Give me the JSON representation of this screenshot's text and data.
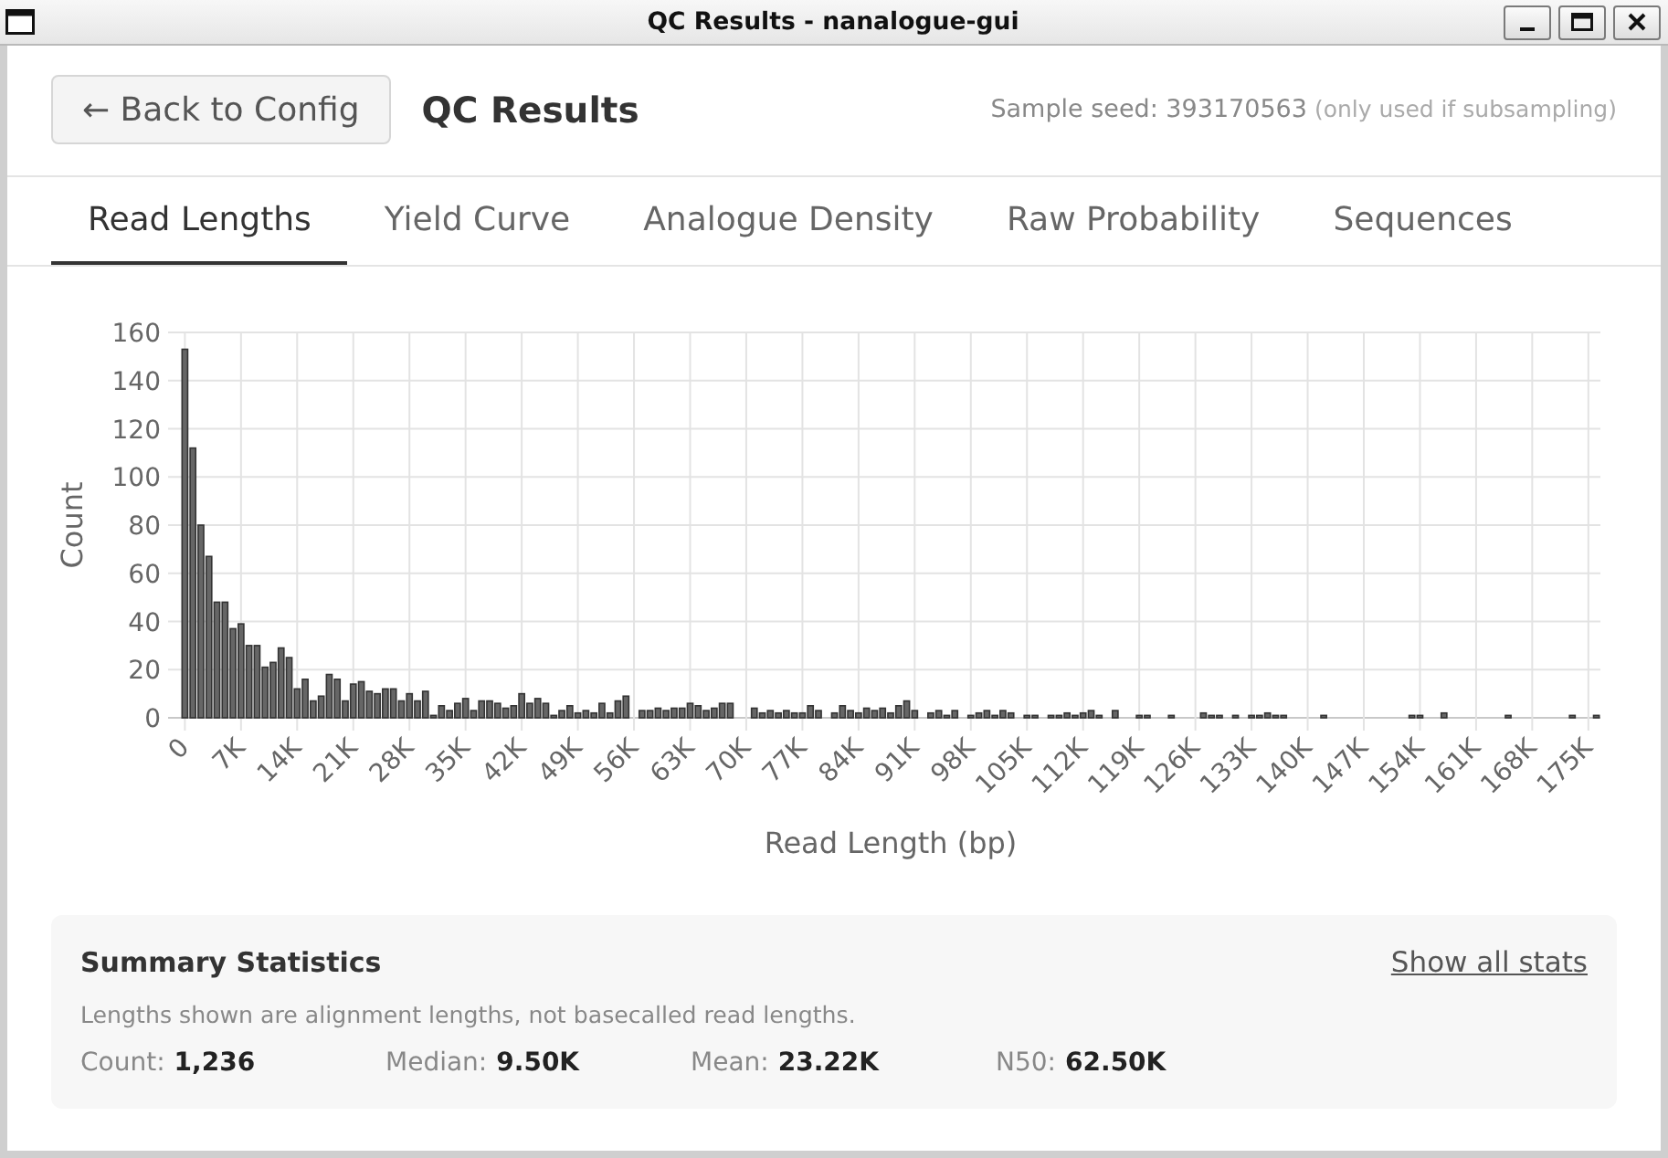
{
  "window": {
    "title": "QC Results - nanalogue-gui"
  },
  "header": {
    "back_button": "← Back to Config",
    "title": "QC Results",
    "seed": "Sample seed: 393170563",
    "seed_note": "(only used if subsampling)"
  },
  "tabs": [
    {
      "label": "Read Lengths",
      "selected": true
    },
    {
      "label": "Yield Curve",
      "selected": false
    },
    {
      "label": "Analogue Density",
      "selected": false
    },
    {
      "label": "Raw Probability",
      "selected": false
    },
    {
      "label": "Sequences",
      "selected": false
    }
  ],
  "chart": {
    "chart_data": {
      "type": "bar",
      "xlabel": "Read Length (bp)",
      "ylabel": "Count",
      "grid": true,
      "x": [
        0,
        1000,
        2000,
        3000,
        4000,
        5000,
        6000,
        7000,
        8000,
        9000,
        10000,
        11000,
        12000,
        13000,
        14000,
        15000,
        16000,
        17000,
        18000,
        19000,
        20000,
        21000,
        22000,
        23000,
        24000,
        25000,
        26000,
        27000,
        28000,
        29000,
        30000,
        31000,
        32000,
        33000,
        34000,
        35000,
        36000,
        37000,
        38000,
        39000,
        40000,
        41000,
        42000,
        43000,
        44000,
        45000,
        46000,
        47000,
        48000,
        49000,
        50000,
        51000,
        52000,
        53000,
        54000,
        55000,
        56000,
        57000,
        58000,
        59000,
        60000,
        61000,
        62000,
        63000,
        64000,
        65000,
        66000,
        67000,
        68000,
        69000,
        70000,
        71000,
        72000,
        73000,
        74000,
        75000,
        76000,
        77000,
        78000,
        79000,
        80000,
        81000,
        82000,
        83000,
        84000,
        85000,
        86000,
        87000,
        88000,
        89000,
        90000,
        91000,
        92000,
        93000,
        94000,
        95000,
        96000,
        97000,
        98000,
        99000,
        100000,
        101000,
        102000,
        103000,
        104000,
        105000,
        106000,
        107000,
        108000,
        109000,
        110000,
        111000,
        112000,
        113000,
        114000,
        115000,
        116000,
        117000,
        118000,
        119000,
        120000,
        121000,
        122000,
        123000,
        124000,
        125000,
        126000,
        127000,
        128000,
        129000,
        130000,
        131000,
        132000,
        133000,
        134000,
        135000,
        136000,
        137000,
        138000,
        139000,
        140000,
        141000,
        142000,
        143000,
        144000,
        145000,
        146000,
        147000,
        148000,
        149000,
        150000,
        151000,
        152000,
        153000,
        154000,
        155000,
        156000,
        157000,
        158000,
        159000,
        160000,
        161000,
        162000,
        163000,
        164000,
        165000,
        166000,
        167000,
        168000,
        169000,
        170000,
        171000,
        172000,
        173000,
        174000,
        175000,
        176000
      ],
      "values": [
        153,
        112,
        80,
        67,
        48,
        48,
        37,
        39,
        30,
        30,
        21,
        23,
        29,
        25,
        12,
        16,
        7,
        9,
        18,
        16,
        7,
        14,
        15,
        11,
        10,
        12,
        12,
        7,
        10,
        7,
        11,
        1,
        5,
        3,
        6,
        8,
        3,
        7,
        7,
        6,
        4,
        5,
        10,
        6,
        8,
        6,
        1,
        3,
        5,
        2,
        3,
        2,
        6,
        2,
        7,
        9,
        0,
        3,
        3,
        4,
        3,
        4,
        4,
        6,
        5,
        3,
        4,
        6,
        6,
        0,
        0,
        4,
        2,
        3,
        2,
        3,
        2,
        2,
        5,
        3,
        0,
        2,
        5,
        3,
        2,
        4,
        3,
        4,
        2,
        5,
        7,
        3,
        0,
        2,
        3,
        1,
        3,
        0,
        1,
        2,
        3,
        1,
        3,
        2,
        0,
        1,
        1,
        0,
        1,
        1,
        2,
        1,
        2,
        3,
        1,
        0,
        3,
        0,
        0,
        1,
        1,
        0,
        0,
        1,
        0,
        0,
        0,
        2,
        1,
        1,
        0,
        1,
        0,
        1,
        1,
        2,
        1,
        1,
        0,
        0,
        0,
        0,
        1,
        0,
        0,
        0,
        0,
        0,
        0,
        0,
        0,
        0,
        0,
        1,
        1,
        0,
        0,
        2,
        0,
        0,
        0,
        0,
        0,
        0,
        0,
        1,
        0,
        0,
        0,
        0,
        0,
        0,
        0,
        1,
        0,
        0,
        1
      ],
      "xlim": [
        -500,
        176500
      ],
      "ylim": [
        0,
        160
      ],
      "xticks": [
        {
          "value": 0,
          "label": "0"
        },
        {
          "value": 7000,
          "label": "7K"
        },
        {
          "value": 14000,
          "label": "14K"
        },
        {
          "value": 21000,
          "label": "21K"
        },
        {
          "value": 28000,
          "label": "28K"
        },
        {
          "value": 35000,
          "label": "35K"
        },
        {
          "value": 42000,
          "label": "42K"
        },
        {
          "value": 49000,
          "label": "49K"
        },
        {
          "value": 56000,
          "label": "56K"
        },
        {
          "value": 63000,
          "label": "63K"
        },
        {
          "value": 70000,
          "label": "70K"
        },
        {
          "value": 77000,
          "label": "77K"
        },
        {
          "value": 84000,
          "label": "84K"
        },
        {
          "value": 91000,
          "label": "91K"
        },
        {
          "value": 98000,
          "label": "98K"
        },
        {
          "value": 105000,
          "label": "105K"
        },
        {
          "value": 112000,
          "label": "112K"
        },
        {
          "value": 119000,
          "label": "119K"
        },
        {
          "value": 126000,
          "label": "126K"
        },
        {
          "value": 133000,
          "label": "133K"
        },
        {
          "value": 140000,
          "label": "140K"
        },
        {
          "value": 147000,
          "label": "147K"
        },
        {
          "value": 154000,
          "label": "154K"
        },
        {
          "value": 161000,
          "label": "161K"
        },
        {
          "value": 168000,
          "label": "168K"
        },
        {
          "value": 175000,
          "label": "175K"
        }
      ],
      "yticks": [
        0,
        20,
        40,
        60,
        80,
        100,
        120,
        140,
        160
      ]
    }
  },
  "summary": {
    "title": "Summary Statistics",
    "link": "Show all stats",
    "note": "Lengths shown are alignment lengths, not basecalled read lengths.",
    "stats": [
      {
        "label": "Count:",
        "value": "1,236"
      },
      {
        "label": "Median:",
        "value": "9.50K"
      },
      {
        "label": "Mean:",
        "value": "23.22K"
      },
      {
        "label": "N50:",
        "value": "62.50K"
      }
    ]
  }
}
